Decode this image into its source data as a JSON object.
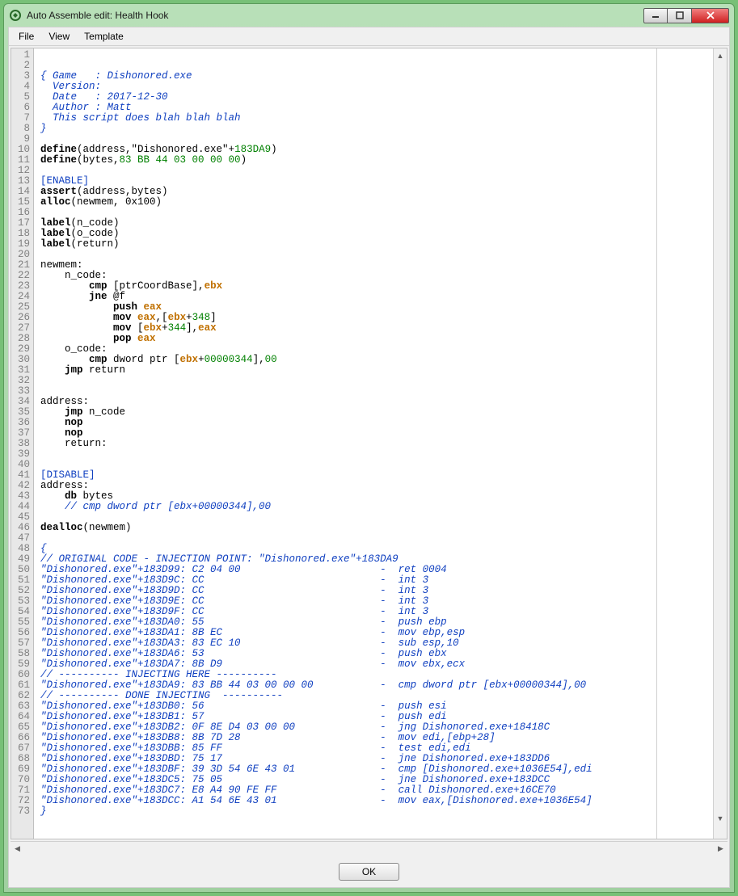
{
  "window": {
    "title": "Auto Assemble edit: Health Hook"
  },
  "menu": {
    "file": "File",
    "view": "View",
    "template": "Template"
  },
  "buttons": {
    "ok": "OK"
  },
  "code": {
    "line_count": 73,
    "lines": [
      {
        "n": 1,
        "t": "cm",
        "txt": "{ Game   : Dishonored.exe"
      },
      {
        "n": 2,
        "t": "cm",
        "txt": "  Version:"
      },
      {
        "n": 3,
        "t": "cm",
        "txt": "  Date   : 2017-12-30"
      },
      {
        "n": 4,
        "t": "cm",
        "txt": "  Author : Matt"
      },
      {
        "n": 5,
        "t": "cm",
        "txt": ""
      },
      {
        "n": 6,
        "t": "cm",
        "txt": "  This script does blah blah blah"
      },
      {
        "n": 7,
        "t": "cm",
        "txt": "}"
      },
      {
        "n": 8,
        "t": "",
        "txt": ""
      },
      {
        "n": 9,
        "t": "def1",
        "txt": ""
      },
      {
        "n": 10,
        "t": "def2",
        "txt": ""
      },
      {
        "n": 11,
        "t": "",
        "txt": ""
      },
      {
        "n": 12,
        "t": "sec",
        "txt": "[ENABLE]"
      },
      {
        "n": 13,
        "t": "assert",
        "txt": ""
      },
      {
        "n": 14,
        "t": "alloc",
        "txt": ""
      },
      {
        "n": 15,
        "t": "",
        "txt": ""
      },
      {
        "n": 16,
        "t": "label",
        "txt": "n_code"
      },
      {
        "n": 17,
        "t": "label",
        "txt": "o_code"
      },
      {
        "n": 18,
        "t": "label",
        "txt": "return"
      },
      {
        "n": 19,
        "t": "",
        "txt": ""
      },
      {
        "n": 20,
        "t": "plain",
        "txt": "newmem:"
      },
      {
        "n": 21,
        "t": "plain",
        "txt": "    n_code:"
      },
      {
        "n": 22,
        "t": "cmp1",
        "txt": ""
      },
      {
        "n": 23,
        "t": "jne",
        "txt": ""
      },
      {
        "n": 24,
        "t": "push",
        "txt": ""
      },
      {
        "n": 25,
        "t": "mov1",
        "txt": ""
      },
      {
        "n": 26,
        "t": "mov2",
        "txt": ""
      },
      {
        "n": 27,
        "t": "pop",
        "txt": ""
      },
      {
        "n": 28,
        "t": "plain",
        "txt": "    o_code:"
      },
      {
        "n": 29,
        "t": "cmp2",
        "txt": ""
      },
      {
        "n": 30,
        "t": "jmp",
        "txt": "return"
      },
      {
        "n": 31,
        "t": "",
        "txt": ""
      },
      {
        "n": 32,
        "t": "",
        "txt": ""
      },
      {
        "n": 33,
        "t": "plain",
        "txt": "address:"
      },
      {
        "n": 34,
        "t": "jmp",
        "txt": "n_code"
      },
      {
        "n": 35,
        "t": "nop",
        "txt": ""
      },
      {
        "n": 36,
        "t": "nop",
        "txt": ""
      },
      {
        "n": 37,
        "t": "plain",
        "txt": "    return:"
      },
      {
        "n": 38,
        "t": "",
        "txt": ""
      },
      {
        "n": 39,
        "t": "",
        "txt": ""
      },
      {
        "n": 40,
        "t": "sec",
        "txt": "[DISABLE]"
      },
      {
        "n": 41,
        "t": "plain",
        "txt": "address:"
      },
      {
        "n": 42,
        "t": "db",
        "txt": ""
      },
      {
        "n": 43,
        "t": "cm",
        "txt": "    // cmp dword ptr [ebx+00000344],00"
      },
      {
        "n": 44,
        "t": "",
        "txt": ""
      },
      {
        "n": 45,
        "t": "dealloc",
        "txt": ""
      },
      {
        "n": 46,
        "t": "",
        "txt": ""
      },
      {
        "n": 47,
        "t": "cm",
        "txt": "{"
      },
      {
        "n": 48,
        "t": "cm",
        "txt": "// ORIGINAL CODE - INJECTION POINT: \"Dishonored.exe\"+183DA9"
      },
      {
        "n": 49,
        "t": "cm",
        "txt": ""
      },
      {
        "n": 50,
        "t": "cm",
        "txt": "\"Dishonored.exe\"+183D99: C2 04 00                       -  ret 0004"
      },
      {
        "n": 51,
        "t": "cm",
        "txt": "\"Dishonored.exe\"+183D9C: CC                             -  int 3"
      },
      {
        "n": 52,
        "t": "cm",
        "txt": "\"Dishonored.exe\"+183D9D: CC                             -  int 3"
      },
      {
        "n": 53,
        "t": "cm",
        "txt": "\"Dishonored.exe\"+183D9E: CC                             -  int 3"
      },
      {
        "n": 54,
        "t": "cm",
        "txt": "\"Dishonored.exe\"+183D9F: CC                             -  int 3"
      },
      {
        "n": 55,
        "t": "cm",
        "txt": "\"Dishonored.exe\"+183DA0: 55                             -  push ebp"
      },
      {
        "n": 56,
        "t": "cm",
        "txt": "\"Dishonored.exe\"+183DA1: 8B EC                          -  mov ebp,esp"
      },
      {
        "n": 57,
        "t": "cm",
        "txt": "\"Dishonored.exe\"+183DA3: 83 EC 10                       -  sub esp,10"
      },
      {
        "n": 58,
        "t": "cm",
        "txt": "\"Dishonored.exe\"+183DA6: 53                             -  push ebx"
      },
      {
        "n": 59,
        "t": "cm",
        "txt": "\"Dishonored.exe\"+183DA7: 8B D9                          -  mov ebx,ecx"
      },
      {
        "n": 60,
        "t": "cm",
        "txt": "// ---------- INJECTING HERE ----------"
      },
      {
        "n": 61,
        "t": "cm",
        "txt": "\"Dishonored.exe\"+183DA9: 83 BB 44 03 00 00 00           -  cmp dword ptr [ebx+00000344],00"
      },
      {
        "n": 62,
        "t": "cm",
        "txt": "// ---------- DONE INJECTING  ----------"
      },
      {
        "n": 63,
        "t": "cm",
        "txt": "\"Dishonored.exe\"+183DB0: 56                             -  push esi"
      },
      {
        "n": 64,
        "t": "cm",
        "txt": "\"Dishonored.exe\"+183DB1: 57                             -  push edi"
      },
      {
        "n": 65,
        "t": "cm",
        "txt": "\"Dishonored.exe\"+183DB2: 0F 8E D4 03 00 00              -  jng Dishonored.exe+18418C"
      },
      {
        "n": 66,
        "t": "cm",
        "txt": "\"Dishonored.exe\"+183DB8: 8B 7D 28                       -  mov edi,[ebp+28]"
      },
      {
        "n": 67,
        "t": "cm",
        "txt": "\"Dishonored.exe\"+183DBB: 85 FF                          -  test edi,edi"
      },
      {
        "n": 68,
        "t": "cm",
        "txt": "\"Dishonored.exe\"+183DBD: 75 17                          -  jne Dishonored.exe+183DD6"
      },
      {
        "n": 69,
        "t": "cm",
        "txt": "\"Dishonored.exe\"+183DBF: 39 3D 54 6E 43 01              -  cmp [Dishonored.exe+1036E54],edi"
      },
      {
        "n": 70,
        "t": "cm",
        "txt": "\"Dishonored.exe\"+183DC5: 75 05                          -  jne Dishonored.exe+183DCC"
      },
      {
        "n": 71,
        "t": "cm",
        "txt": "\"Dishonored.exe\"+183DC7: E8 A4 90 FE FF                 -  call Dishonored.exe+16CE70"
      },
      {
        "n": 72,
        "t": "cm",
        "txt": "\"Dishonored.exe\"+183DCC: A1 54 6E 43 01                 -  mov eax,[Dishonored.exe+1036E54]"
      },
      {
        "n": 73,
        "t": "cm",
        "txt": "}"
      }
    ]
  }
}
